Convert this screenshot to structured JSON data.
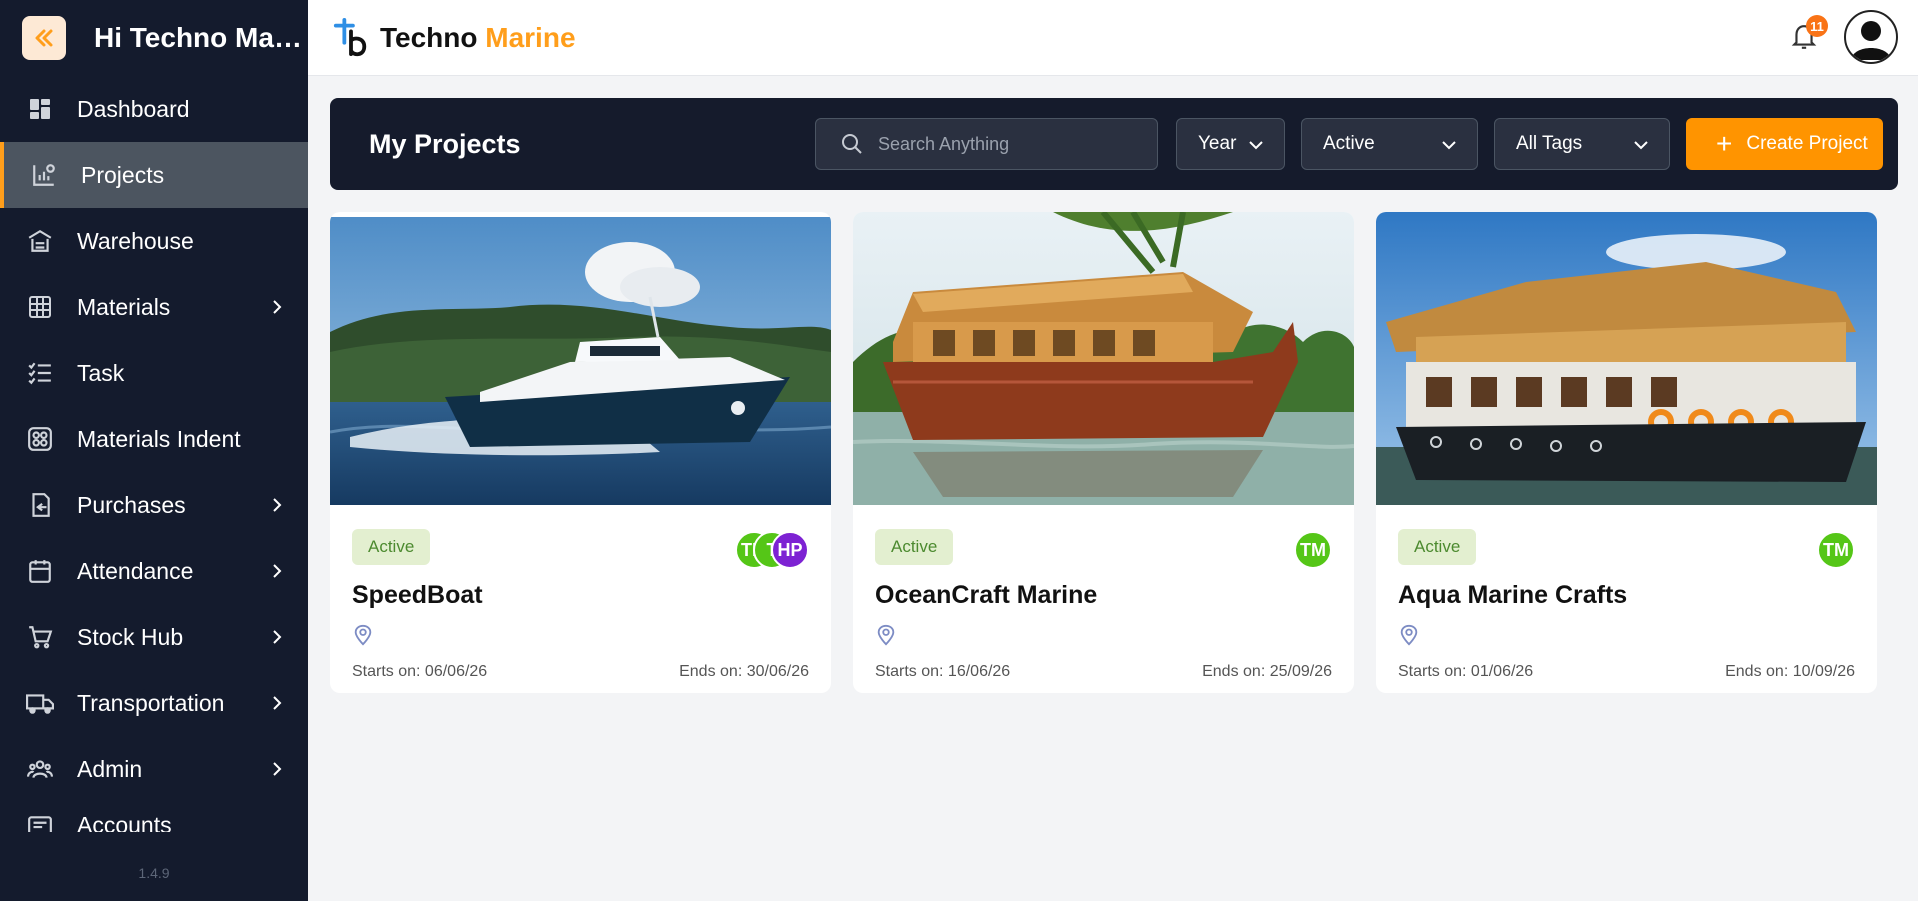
{
  "sidebar": {
    "greeting": "Hi Techno Mar...",
    "items": [
      {
        "label": "Dashboard",
        "icon": "dashboard-icon"
      },
      {
        "label": "Projects",
        "icon": "projects-icon",
        "active": true
      },
      {
        "label": "Warehouse",
        "icon": "warehouse-icon"
      },
      {
        "label": "Materials",
        "icon": "materials-icon",
        "expandable": true
      },
      {
        "label": "Task",
        "icon": "task-icon"
      },
      {
        "label": "Materials Indent",
        "icon": "materials-indent-icon"
      },
      {
        "label": "Purchases",
        "icon": "purchases-icon",
        "expandable": true
      },
      {
        "label": "Attendance",
        "icon": "attendance-icon",
        "expandable": true
      },
      {
        "label": "Stock Hub",
        "icon": "stock-hub-icon",
        "expandable": true
      },
      {
        "label": "Transportation",
        "icon": "truck-icon",
        "expandable": true
      },
      {
        "label": "Admin",
        "icon": "admin-icon",
        "expandable": true
      },
      {
        "label": "Accounts",
        "icon": "accounts-icon"
      }
    ],
    "version": "1.4.9"
  },
  "topbar": {
    "brand_main": "Techno",
    "brand_accent": "Marine",
    "notification_count": "11"
  },
  "header": {
    "title": "My Projects",
    "search_placeholder": "Search Anything",
    "filter_year": "Year",
    "filter_status": "Active",
    "filter_tags": "All Tags",
    "create_label": "Create Project"
  },
  "projects": [
    {
      "status": "Active",
      "title": "SpeedBoat",
      "avatars": [
        "TM",
        "T",
        "HP"
      ],
      "starts": "Starts on: 06/06/26",
      "ends": "Ends on: 30/06/26"
    },
    {
      "status": "Active",
      "title": "OceanCraft Marine",
      "avatars": [
        "TM"
      ],
      "starts": "Starts on: 16/06/26",
      "ends": "Ends on: 25/09/26"
    },
    {
      "status": "Active",
      "title": "Aqua Marine Crafts",
      "avatars": [
        "TM"
      ],
      "starts": "Starts on: 01/06/26",
      "ends": "Ends on: 10/09/26"
    }
  ],
  "colors": {
    "accent": "#ff9400",
    "sidebar_bg": "#141b2d",
    "active_nav_bg": "#4c5560",
    "status_bg": "#e3efd0",
    "avatar_green": "#55c617",
    "avatar_purple": "#7d22d3"
  }
}
